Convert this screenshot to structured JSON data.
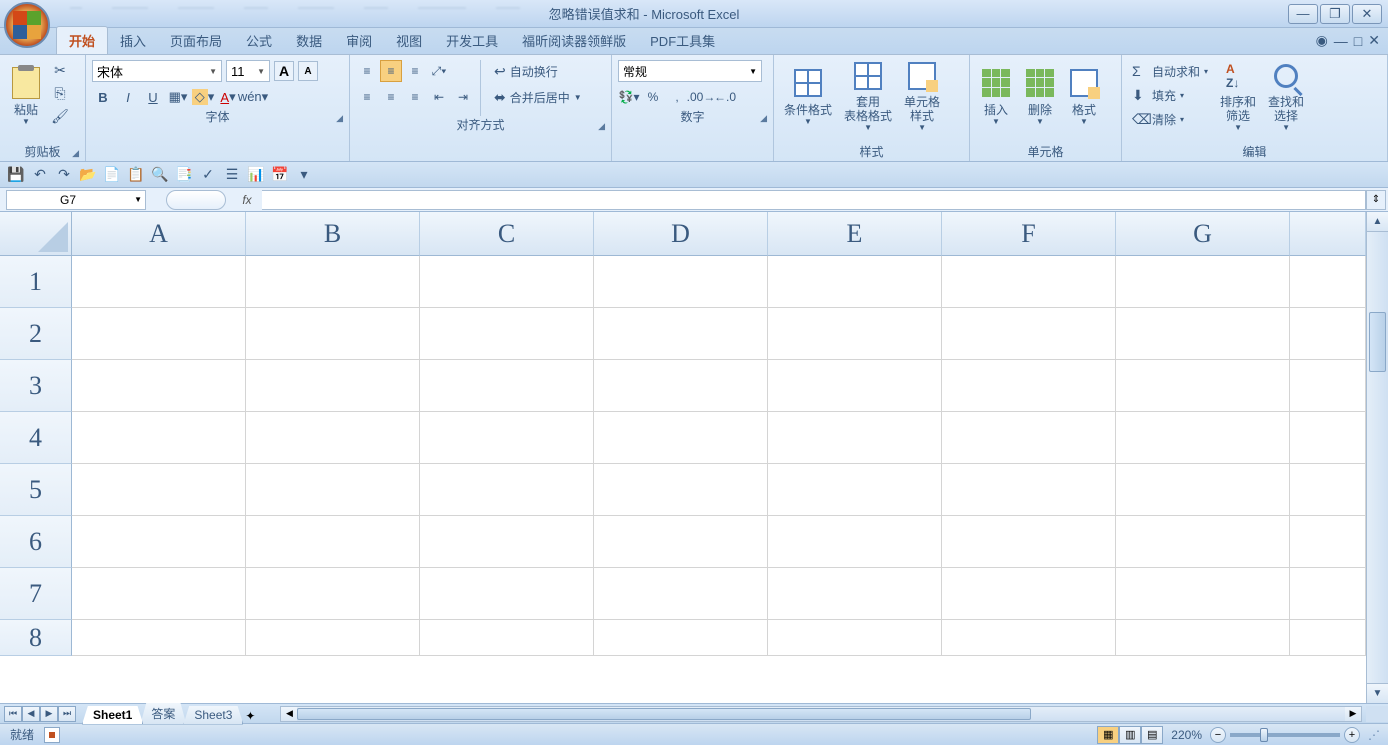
{
  "title": "忽略错误值求和 - Microsoft Excel",
  "tabs": [
    "开始",
    "插入",
    "页面布局",
    "公式",
    "数据",
    "审阅",
    "视图",
    "开发工具",
    "福昕阅读器领鲜版",
    "PDF工具集"
  ],
  "ribbon": {
    "clipboard": {
      "label": "剪贴板",
      "paste": "粘贴"
    },
    "font": {
      "label": "字体",
      "name": "宋体",
      "size": "11",
      "incA": "A",
      "decA": "A",
      "bold": "B",
      "italic": "I",
      "underline": "U"
    },
    "align": {
      "label": "对齐方式",
      "wrap": "自动换行",
      "merge": "合并后居中"
    },
    "number": {
      "label": "数字",
      "format": "常规"
    },
    "style": {
      "label": "样式",
      "cond": "条件格式",
      "table": "套用\n表格格式",
      "cell": "单元格\n样式"
    },
    "cells": {
      "label": "单元格",
      "insert": "插入",
      "delete": "删除",
      "format": "格式"
    },
    "edit": {
      "label": "编辑",
      "sum": "自动求和",
      "fill": "填充",
      "clear": "清除",
      "sort": "排序和\n筛选",
      "find": "查找和\n选择"
    }
  },
  "namebox": "G7",
  "fx": "fx",
  "columns": [
    "A",
    "B",
    "C",
    "D",
    "E",
    "F",
    "G"
  ],
  "rows": [
    "1",
    "2",
    "3",
    "4",
    "5",
    "6",
    "7",
    "8"
  ],
  "sheets": [
    "Sheet1",
    "答案",
    "Sheet3"
  ],
  "status": "就绪",
  "zoom": "220%",
  "sigma": "Σ"
}
